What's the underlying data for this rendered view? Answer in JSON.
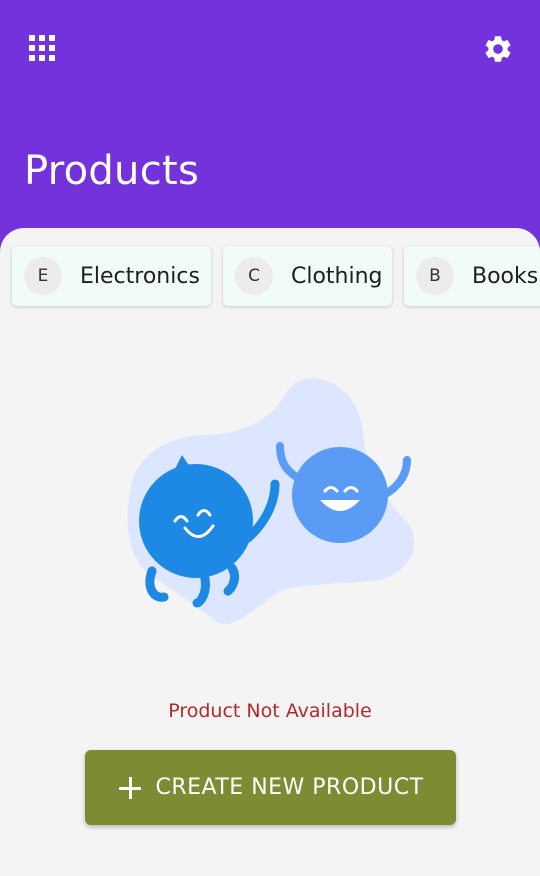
{
  "header": {
    "title": "Products",
    "apps_icon": "grid-apps-icon",
    "settings_icon": "gear-icon"
  },
  "categories": [
    {
      "initial": "E",
      "label": "Electronics"
    },
    {
      "initial": "C",
      "label": "Clothing"
    },
    {
      "initial": "B",
      "label": "Books"
    }
  ],
  "empty_state": {
    "message": "Product Not Available"
  },
  "actions": {
    "create_label": "CREATE NEW PRODUCT",
    "create_icon": "plus-icon"
  },
  "colors": {
    "header_bg": "#7432dd",
    "content_bg": "#f4f4f4",
    "chip_bg": "#f1fbf8",
    "error_text": "#b22a2a",
    "button_bg": "#7d8c33",
    "mascot_dark": "#1e88e5",
    "mascot_light": "#5a9bf6",
    "blob": "#dce7ff"
  }
}
